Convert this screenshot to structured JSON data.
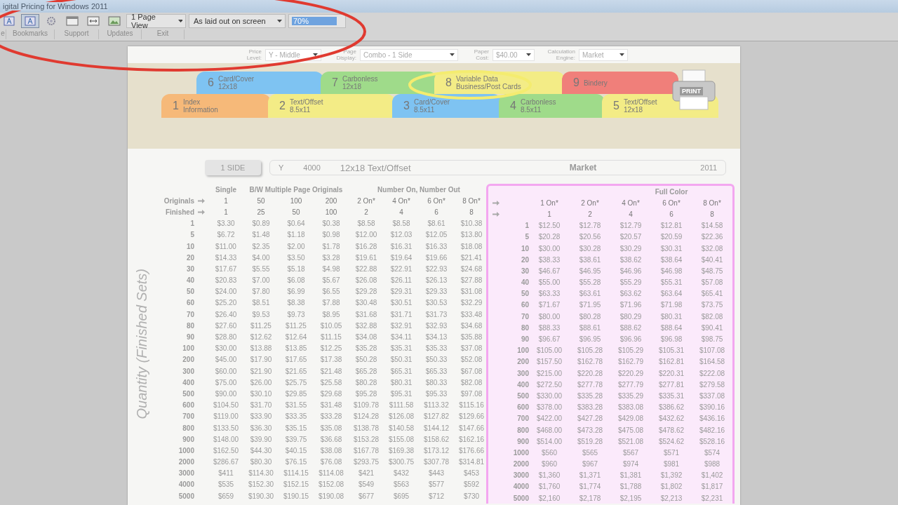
{
  "window": {
    "title": "igital Pricing for Windows 2011"
  },
  "toolbar": {
    "icon_buttons": [
      {
        "kind": "text"
      },
      {
        "kind": "text",
        "selected": true
      },
      {
        "kind": "gear"
      },
      {
        "kind": "page"
      },
      {
        "kind": "width"
      },
      {
        "kind": "image"
      }
    ],
    "dropdowns": [
      {
        "value": "1 Page View",
        "focused": false
      },
      {
        "value": "As laid out on screen",
        "focused": false
      },
      {
        "value": "70%",
        "focused": true
      }
    ],
    "labels": [
      "e",
      "Bookmarks",
      "Support",
      "Updates",
      "Exit"
    ]
  },
  "settings": [
    {
      "label": "Price Level:",
      "value": "Y - Middle"
    },
    {
      "label": "Page Display:",
      "value": "Combo - 1 Side"
    },
    {
      "label": "Paper Cost:",
      "value": "$40.00"
    },
    {
      "label": "Calculation Engine:",
      "value": "Market"
    }
  ],
  "tabs": {
    "back": [
      {
        "number": "6",
        "title": "Card/Cover",
        "subtitle": "12x18",
        "color": "#7ec3f2"
      },
      {
        "number": "7",
        "title": "Carbonless",
        "subtitle": "12x18",
        "color": "#9fdb8a"
      },
      {
        "number": "8",
        "title": "Variable Data",
        "subtitle": "Business/Post Cards",
        "color": "#f3ec86"
      },
      {
        "number": "9",
        "title": "Bindery",
        "color": "#f07f7a"
      }
    ],
    "front": [
      {
        "number": "1",
        "title": "Index",
        "subtitle": "Information",
        "color": "#f6b979"
      },
      {
        "number": "2",
        "title": "Text/Offset",
        "subtitle": "8.5x11",
        "color": "#f3ec86"
      },
      {
        "number": "3",
        "title": "Card/Cover",
        "subtitle": "8.5x11",
        "color": "#7ec3f2"
      },
      {
        "number": "4",
        "title": "Carbonless",
        "subtitle": "8.5x11",
        "color": "#9fdb8a"
      },
      {
        "number": "5",
        "title": "Text/Offset",
        "subtitle": "12x18",
        "color": "#f3ec86"
      }
    ]
  },
  "print_label": "PRINT",
  "summary": {
    "side": "1 SIDE",
    "level": "Y",
    "quantity": "4000",
    "paper": "12x18 Text/Offset",
    "engine": "Market",
    "year": "2011"
  },
  "table": {
    "axis_label": "Quantity (Finished Sets)",
    "originals_label": "Originals",
    "finished_label": "Finished",
    "groups": [
      {
        "label": "Single"
      },
      {
        "label": "B/W Multiple Page Originals"
      },
      {
        "label": "Number On, Number Out"
      }
    ],
    "full_color_label": "Full Color",
    "columns": [
      {
        "original": "1",
        "finished": "1"
      },
      {
        "original": "50",
        "finished": "25"
      },
      {
        "original": "100",
        "finished": "50"
      },
      {
        "original": "200",
        "finished": "100"
      },
      {
        "original": "2 On*",
        "finished": "2"
      },
      {
        "original": "4 On*",
        "finished": "4"
      },
      {
        "original": "6 On*",
        "finished": "6"
      },
      {
        "original": "8 On*",
        "finished": "8"
      }
    ],
    "fc_columns": [
      {
        "original": "1 On*",
        "finished": "1"
      },
      {
        "original": "2 On*",
        "finished": "2"
      },
      {
        "original": "4 On*",
        "finished": "4"
      },
      {
        "original": "6 On*",
        "finished": "6"
      },
      {
        "original": "8 On*",
        "finished": "8"
      }
    ],
    "rows": [
      {
        "qty": "1",
        "cells": [
          "$3.30",
          "$0.89",
          "$0.64",
          "$0.38",
          "$8.58",
          "$8.58",
          "$8.61",
          "$10.38"
        ],
        "fc_qty": "1",
        "fc_cells": [
          "$12.50",
          "$12.78",
          "$12.79",
          "$12.81",
          "$14.58"
        ]
      },
      {
        "qty": "5",
        "cells": [
          "$6.72",
          "$1.48",
          "$1.18",
          "$0.98",
          "$12.00",
          "$12.03",
          "$12.05",
          "$13.80"
        ],
        "fc_qty": "5",
        "fc_cells": [
          "$20.28",
          "$20.56",
          "$20.57",
          "$20.59",
          "$22.36"
        ]
      },
      {
        "qty": "10",
        "cells": [
          "$11.00",
          "$2.35",
          "$2.00",
          "$1.78",
          "$16.28",
          "$16.31",
          "$16.33",
          "$18.08"
        ],
        "fc_qty": "10",
        "fc_cells": [
          "$30.00",
          "$30.28",
          "$30.29",
          "$30.31",
          "$32.08"
        ]
      },
      {
        "qty": "20",
        "cells": [
          "$14.33",
          "$4.00",
          "$3.50",
          "$3.28",
          "$19.61",
          "$19.64",
          "$19.66",
          "$21.41"
        ],
        "fc_qty": "20",
        "fc_cells": [
          "$38.33",
          "$38.61",
          "$38.62",
          "$38.64",
          "$40.41"
        ]
      },
      {
        "qty": "30",
        "cells": [
          "$17.67",
          "$5.55",
          "$5.18",
          "$4.98",
          "$22.88",
          "$22.91",
          "$22.93",
          "$24.68"
        ],
        "fc_qty": "30",
        "fc_cells": [
          "$46.67",
          "$46.95",
          "$46.96",
          "$46.98",
          "$48.75"
        ]
      },
      {
        "qty": "40",
        "cells": [
          "$20.83",
          "$7.00",
          "$6.08",
          "$5.67",
          "$26.08",
          "$26.11",
          "$26.13",
          "$27.88"
        ],
        "fc_qty": "40",
        "fc_cells": [
          "$55.00",
          "$55.28",
          "$55.29",
          "$55.31",
          "$57.08"
        ]
      },
      {
        "qty": "50",
        "cells": [
          "$24.00",
          "$7.80",
          "$6.99",
          "$6.55",
          "$29.28",
          "$29.31",
          "$29.33",
          "$31.08"
        ],
        "fc_qty": "50",
        "fc_cells": [
          "$63.33",
          "$63.61",
          "$63.62",
          "$63.64",
          "$65.41"
        ]
      },
      {
        "qty": "60",
        "cells": [
          "$25.20",
          "$8.51",
          "$8.38",
          "$7.88",
          "$30.48",
          "$30.51",
          "$30.53",
          "$32.29"
        ],
        "fc_qty": "60",
        "fc_cells": [
          "$71.67",
          "$71.95",
          "$71.96",
          "$71.98",
          "$73.75"
        ]
      },
      {
        "qty": "70",
        "cells": [
          "$26.40",
          "$9.53",
          "$9.73",
          "$8.95",
          "$31.68",
          "$31.71",
          "$31.73",
          "$33.48"
        ],
        "fc_qty": "70",
        "fc_cells": [
          "$80.00",
          "$80.28",
          "$80.29",
          "$80.31",
          "$82.08"
        ]
      },
      {
        "qty": "80",
        "cells": [
          "$27.60",
          "$11.25",
          "$11.25",
          "$10.05",
          "$32.88",
          "$32.91",
          "$32.93",
          "$34.68"
        ],
        "fc_qty": "80",
        "fc_cells": [
          "$88.33",
          "$88.61",
          "$88.62",
          "$88.64",
          "$90.41"
        ]
      },
      {
        "qty": "90",
        "cells": [
          "$28.80",
          "$12.62",
          "$12.64",
          "$11.15",
          "$34.08",
          "$34.11",
          "$34.13",
          "$35.88"
        ],
        "fc_qty": "90",
        "fc_cells": [
          "$96.67",
          "$96.95",
          "$96.96",
          "$96.98",
          "$98.75"
        ]
      },
      {
        "qty": "100",
        "cells": [
          "$30.00",
          "$13.88",
          "$13.85",
          "$12.25",
          "$35.28",
          "$35.31",
          "$35.33",
          "$37.08"
        ],
        "fc_qty": "100",
        "fc_cells": [
          "$105.00",
          "$105.28",
          "$105.29",
          "$105.31",
          "$107.08"
        ]
      },
      {
        "qty": "200",
        "cells": [
          "$45.00",
          "$17.90",
          "$17.65",
          "$17.38",
          "$50.28",
          "$50.31",
          "$50.33",
          "$52.08"
        ],
        "fc_qty": "200",
        "fc_cells": [
          "$157.50",
          "$162.78",
          "$162.79",
          "$162.81",
          "$164.58"
        ]
      },
      {
        "qty": "300",
        "cells": [
          "$60.00",
          "$21.90",
          "$21.65",
          "$21.48",
          "$65.28",
          "$65.31",
          "$65.33",
          "$67.08"
        ],
        "fc_qty": "300",
        "fc_cells": [
          "$215.00",
          "$220.28",
          "$220.29",
          "$220.31",
          "$222.08"
        ]
      },
      {
        "qty": "400",
        "cells": [
          "$75.00",
          "$26.00",
          "$25.75",
          "$25.58",
          "$80.28",
          "$80.31",
          "$80.33",
          "$82.08"
        ],
        "fc_qty": "400",
        "fc_cells": [
          "$272.50",
          "$277.78",
          "$277.79",
          "$277.81",
          "$279.58"
        ]
      },
      {
        "qty": "500",
        "cells": [
          "$90.00",
          "$30.10",
          "$29.85",
          "$29.68",
          "$95.28",
          "$95.31",
          "$95.33",
          "$97.08"
        ],
        "fc_qty": "500",
        "fc_cells": [
          "$330.00",
          "$335.28",
          "$335.29",
          "$335.31",
          "$337.08"
        ]
      },
      {
        "qty": "600",
        "cells": [
          "$104.50",
          "$31.70",
          "$31.55",
          "$31.48",
          "$109.78",
          "$111.58",
          "$113.32",
          "$115.16"
        ],
        "fc_qty": "600",
        "fc_cells": [
          "$378.00",
          "$383.28",
          "$383.08",
          "$386.62",
          "$390.16"
        ]
      },
      {
        "qty": "700",
        "cells": [
          "$119.00",
          "$33.90",
          "$33.35",
          "$33.28",
          "$124.28",
          "$126.08",
          "$127.82",
          "$129.66"
        ],
        "fc_qty": "700",
        "fc_cells": [
          "$422.00",
          "$427.28",
          "$429.08",
          "$432.62",
          "$436.16"
        ]
      },
      {
        "qty": "800",
        "cells": [
          "$133.50",
          "$36.30",
          "$35.15",
          "$35.08",
          "$138.78",
          "$140.58",
          "$144.12",
          "$147.66"
        ],
        "fc_qty": "800",
        "fc_cells": [
          "$468.00",
          "$473.28",
          "$475.08",
          "$478.62",
          "$482.16"
        ]
      },
      {
        "qty": "900",
        "cells": [
          "$148.00",
          "$39.90",
          "$39.75",
          "$36.68",
          "$153.28",
          "$155.08",
          "$158.62",
          "$162.16"
        ],
        "fc_qty": "900",
        "fc_cells": [
          "$514.00",
          "$519.28",
          "$521.08",
          "$524.62",
          "$528.16"
        ]
      },
      {
        "qty": "1000",
        "cells": [
          "$162.50",
          "$44.30",
          "$40.15",
          "$38.08",
          "$167.78",
          "$169.38",
          "$173.12",
          "$176.66"
        ],
        "fc_qty": "1000",
        "fc_cells": [
          "$560",
          "$565",
          "$567",
          "$571",
          "$574"
        ]
      },
      {
        "qty": "2000",
        "cells": [
          "$286.67",
          "$80.30",
          "$76.15",
          "$76.08",
          "$293.75",
          "$300.75",
          "$307.78",
          "$314.81"
        ],
        "fc_qty": "2000",
        "fc_cells": [
          "$960",
          "$967",
          "$974",
          "$981",
          "$988"
        ]
      },
      {
        "qty": "3000",
        "cells": [
          "$411",
          "$114.30",
          "$114.15",
          "$114.08",
          "$421",
          "$432",
          "$443",
          "$453"
        ],
        "fc_qty": "3000",
        "fc_cells": [
          "$1,360",
          "$1,371",
          "$1,381",
          "$1,392",
          "$1,402"
        ]
      },
      {
        "qty": "4000",
        "cells": [
          "$535",
          "$152.30",
          "$152.15",
          "$152.08",
          "$549",
          "$563",
          "$577",
          "$592"
        ],
        "fc_qty": "4000",
        "fc_cells": [
          "$1,760",
          "$1,774",
          "$1,788",
          "$1,802",
          "$1,817"
        ]
      },
      {
        "qty": "5000",
        "cells": [
          "$659",
          "$190.30",
          "$190.15",
          "$190.08",
          "$677",
          "$695",
          "$712",
          "$730"
        ],
        "fc_qty": "5000",
        "fc_cells": [
          "$2,160",
          "$2,178",
          "$2,195",
          "$2,213",
          "$2,231"
        ]
      }
    ]
  }
}
